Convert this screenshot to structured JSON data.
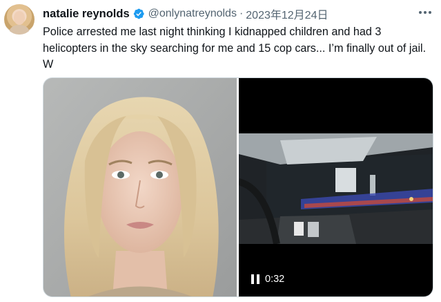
{
  "author": {
    "display_name": "natalie reynolds",
    "handle": "@onlynatreynolds",
    "separator": "·",
    "date": "2023年12月24日",
    "verified": true
  },
  "tweet": {
    "text": "Police arrested me last night thinking I kidnapped children and had 3 helicopters in the sky searching for me and 15 cop cars... I’m finally out of jail. W"
  },
  "media": {
    "photo": {
      "icon": "mugshot-photo"
    },
    "video": {
      "duration": "0:32",
      "state": "paused",
      "icon": "pause-icon"
    }
  },
  "colors": {
    "text_primary": "#0f1419",
    "text_secondary": "#536471",
    "verified_blue": "#1d9bf0",
    "border": "#cfd9de"
  }
}
